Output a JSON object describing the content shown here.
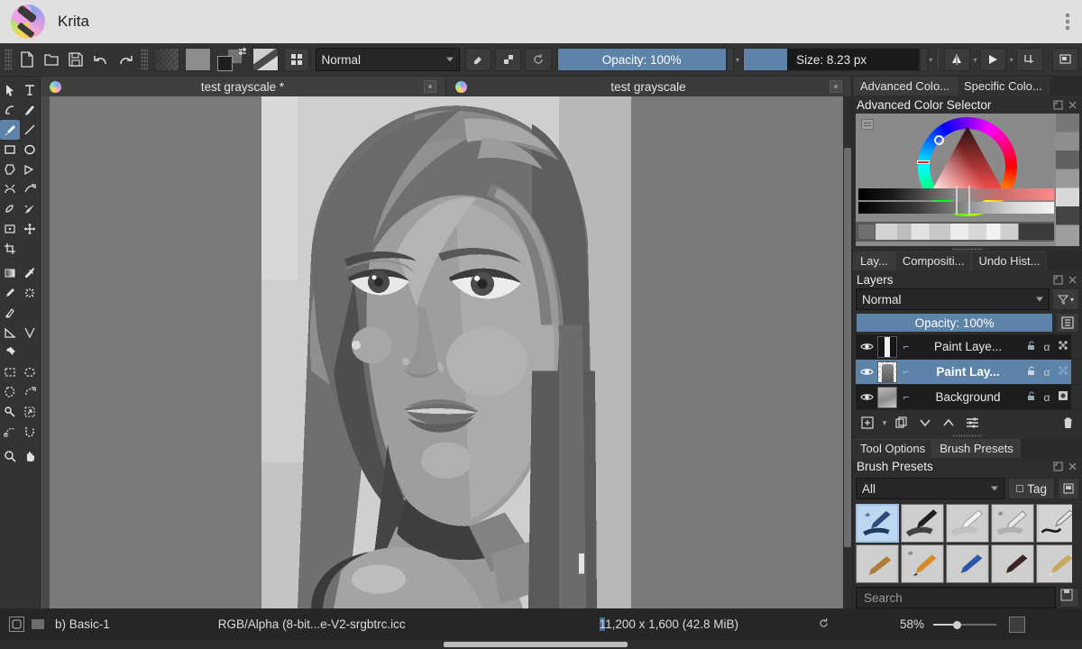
{
  "titlebar": {
    "app_name": "Krita",
    "logo_icon": "krita-logo",
    "menu_icon": "overflow-menu-icon"
  },
  "toolbar": {
    "new_icon": "new-document-icon",
    "open_icon": "open-folder-icon",
    "save_icon": "save-disk-icon",
    "undo_icon": "undo-arrow-icon",
    "redo_icon": "redo-arrow-icon",
    "gradient_swatch": "gradient-preview",
    "pattern_swatch": "pattern-preview",
    "fgbg_swatch": "foreground-background-colors",
    "brush_preset_icon": "brush-preset-preview",
    "presets_icon": "choose-brush-preset-icon",
    "blending_mode": "Normal",
    "eraser_icon": "eraser-toggle-icon",
    "alpha_icon": "preserve-alpha-icon",
    "reload_icon": "reload-preset-icon",
    "opacity_label": "Opacity: 100%",
    "size_label": "Size: 8.23 px",
    "mirror_h_icon": "mirror-horizontal-icon",
    "mirror_v_icon": "mirror-vertical-icon",
    "wrap_icon": "wrap-around-mode-icon",
    "workspace_icon": "workspace-chooser-icon"
  },
  "tools": [
    {
      "name": "select-shapes-tool",
      "icon": "cursor-arrow-icon"
    },
    {
      "name": "text-tool",
      "icon": "text-T-icon"
    },
    {
      "name": "edit-shapes-tool",
      "icon": "node-edit-icon"
    },
    {
      "name": "calligraphy-tool",
      "icon": "calligraphy-pen-icon"
    },
    {
      "name": "freehand-brush-tool",
      "icon": "paintbrush-icon",
      "active": true
    },
    {
      "name": "line-tool",
      "icon": "line-icon"
    },
    {
      "name": "rectangle-tool",
      "icon": "rectangle-icon"
    },
    {
      "name": "ellipse-tool",
      "icon": "ellipse-icon"
    },
    {
      "name": "polygon-tool",
      "icon": "polygon-icon"
    },
    {
      "name": "polyline-tool",
      "icon": "polyline-icon"
    },
    {
      "name": "bezier-curve-tool",
      "icon": "bezier-curve-icon"
    },
    {
      "name": "freehand-path-tool",
      "icon": "freehand-path-icon"
    },
    {
      "name": "dynamic-brush-tool",
      "icon": "dynamic-brush-icon"
    },
    {
      "name": "multibrush-tool",
      "icon": "multibrush-icon"
    },
    {
      "name": "transform-tool",
      "icon": "transform-icon"
    },
    {
      "name": "move-tool",
      "icon": "move-cross-icon"
    },
    {
      "name": "crop-tool",
      "icon": "crop-icon"
    },
    {
      "name": "gradient-tool",
      "icon": "gradient-icon"
    },
    {
      "name": "color-picker-tool",
      "icon": "eyedropper-icon"
    },
    {
      "name": "fill-tool",
      "icon": "paint-bucket-icon"
    },
    {
      "name": "smart-patch-tool",
      "icon": "smart-patch-icon"
    },
    {
      "name": "colorize-mask-tool",
      "icon": "colorize-mask-icon"
    },
    {
      "name": "measure-tool",
      "icon": "measure-angle-icon"
    },
    {
      "name": "assistant-tool",
      "icon": "assistant-icon"
    },
    {
      "name": "reference-images-tool",
      "icon": "pin-icon"
    },
    {
      "name": "rectangular-select-tool",
      "icon": "rect-select-icon"
    },
    {
      "name": "elliptical-select-tool",
      "icon": "ellipse-select-icon"
    },
    {
      "name": "polygonal-select-tool",
      "icon": "polygon-select-icon"
    },
    {
      "name": "freehand-select-tool",
      "icon": "freehand-select-icon"
    },
    {
      "name": "contiguous-select-tool",
      "icon": "magic-wand-icon"
    },
    {
      "name": "similar-color-select-tool",
      "icon": "similar-select-icon"
    },
    {
      "name": "bezier-select-tool",
      "icon": "bezier-select-icon"
    },
    {
      "name": "magnetic-select-tool",
      "icon": "magnetic-select-icon"
    },
    {
      "name": "zoom-tool",
      "icon": "magnifier-icon"
    },
    {
      "name": "pan-tool",
      "icon": "hand-icon"
    }
  ],
  "document_tabs": [
    {
      "title": "test grayscale *",
      "active": true,
      "close_label": "×",
      "icon": "krita-doc-icon"
    },
    {
      "title": "test grayscale",
      "active": false,
      "close_label": "×",
      "icon": "krita-doc-icon"
    }
  ],
  "color_docker": {
    "tabs": [
      {
        "label": "Advanced Colo...",
        "accesskey": "A",
        "active": true
      },
      {
        "label": "Specific Colo...",
        "accesskey": "S",
        "active": false
      }
    ],
    "title": "Advanced Color Selector",
    "float_icon": "float-docker-icon",
    "close_icon": "close-docker-icon",
    "menu_icon": "selector-settings-icon",
    "reset_icon": "reset-history-icon"
  },
  "layers_docker": {
    "tabs": [
      {
        "label": "Lay...",
        "accesskey": "L",
        "active": true
      },
      {
        "label": "Compositi...",
        "accesskey": "C",
        "active": false
      },
      {
        "label": "Undo Hist...",
        "accesskey": "U",
        "active": false
      }
    ],
    "title": "Layers",
    "float_icon": "float-docker-icon",
    "close_icon": "close-docker-icon",
    "blending_mode": "Normal",
    "filter_icon": "layer-filter-icon",
    "opacity_label": "Opacity:  100%",
    "properties_icon": "layer-properties-icon",
    "layers": [
      {
        "name": "Paint Laye...",
        "visible_icon": "eye-icon",
        "selected": false,
        "lock_icon": "unlocked-icon",
        "alpha_icon": "alpha-inherit-icon",
        "extra_icon": "onion-skin-icon"
      },
      {
        "name": "Paint Lay...",
        "visible_icon": "eye-icon",
        "selected": true,
        "lock_icon": "unlocked-icon",
        "alpha_icon": "alpha-inherit-icon",
        "extra_icon": "onion-skin-icon"
      },
      {
        "name": "Background",
        "visible_icon": "eye-icon",
        "selected": false,
        "lock_icon": "unlocked-icon",
        "alpha_icon": "alpha-inherit-icon",
        "extra_icon": "layer-style-icon"
      }
    ],
    "buttons": [
      {
        "name": "add-layer-button",
        "icon": "plus-box-icon"
      },
      {
        "name": "add-layer-dropdown",
        "icon": "chevron-down-small-icon"
      },
      {
        "name": "duplicate-layer-button",
        "icon": "duplicate-icon"
      },
      {
        "name": "move-layer-down-button",
        "icon": "chevron-down-icon"
      },
      {
        "name": "move-layer-up-button",
        "icon": "chevron-up-icon"
      },
      {
        "name": "layer-properties-button",
        "icon": "sliders-icon"
      },
      {
        "name": "delete-layer-button",
        "icon": "trash-icon"
      }
    ]
  },
  "brush_docker": {
    "tabs": [
      {
        "label": "Tool Options",
        "accesskey": "O",
        "active": false
      },
      {
        "label": "Brush Presets",
        "accesskey": "B",
        "active": true
      }
    ],
    "title": "Brush Presets",
    "float_icon": "float-docker-icon",
    "close_icon": "close-docker-icon",
    "tag_filter": "All",
    "tag_button": "Tag",
    "tag_settings_icon": "tag-settings-icon",
    "search_placeholder": "Search",
    "search_value": "",
    "save_icon": "save-preset-icon",
    "presets": [
      {
        "name": "basic-1-preset",
        "selected": true
      },
      {
        "name": "ink-brush-preset",
        "selected": false
      },
      {
        "name": "soft-brush-preset",
        "selected": false
      },
      {
        "name": "airbrush-preset",
        "selected": false
      },
      {
        "name": "ink-pen-preset",
        "selected": false
      },
      {
        "name": "pencil-preset",
        "selected": false
      },
      {
        "name": "marker-preset",
        "selected": false
      },
      {
        "name": "blue-pencil-preset",
        "selected": false
      },
      {
        "name": "dark-pencil-preset",
        "selected": false
      },
      {
        "name": "tan-pencil-preset",
        "selected": false
      }
    ]
  },
  "statusbar": {
    "selection_icon": "selection-mask-icon",
    "hidden_icon": "toggle-selection-icon",
    "brush_preset": "b) Basic-1",
    "color_profile": "RGB/Alpha (8-bit...e-V2-srgbtrc.icc",
    "dimensions": "1,200 x 1,600 (42.8 MiB)",
    "rotation_icon": "reset-rotation-icon",
    "zoom_level": "58%",
    "zoom_slider_icon": "zoom-slider",
    "fit_icon": "fit-to-page-icon"
  },
  "colors": {
    "accent": "#5d83a8",
    "panel_bg": "#2e2e2e",
    "toolbar_bg": "#333333",
    "titlebar_bg": "#e0e0e0",
    "canvas_bg": "#7a7a7a",
    "text": "#e6e6e6"
  }
}
